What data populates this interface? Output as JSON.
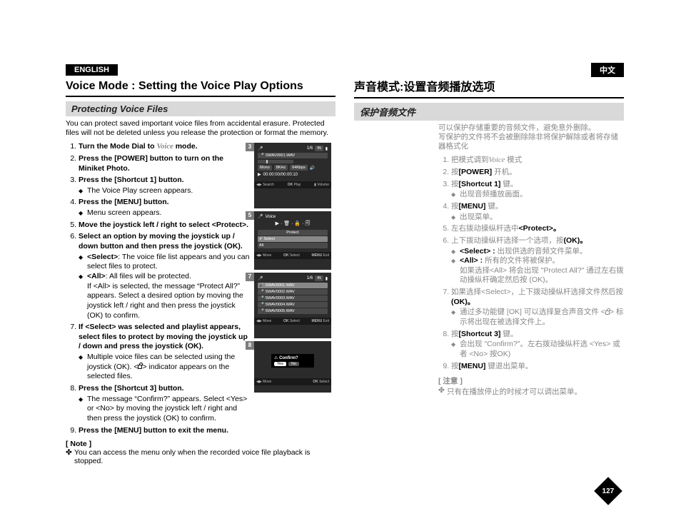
{
  "left": {
    "lang": "ENGLISH",
    "title": "Voice Mode : Setting the Voice Play Options",
    "subtitle": "Protecting Voice Files",
    "intro": "You can protect saved important voice files from accidental erasure. Protected files will not be deleted unless you release the protection or format the memory.",
    "steps": {
      "s1": "Turn the Mode Dial to ",
      "s1_mode": "Voice",
      "s1_tail": " mode.",
      "s2": "Press the [POWER] button to turn on the Miniket Photo.",
      "s3": "Press the [Shortcut 1] button.",
      "s3_sub1": "The Voice Play screen appears.",
      "s4": "Press the [MENU] button.",
      "s4_sub1": "Menu screen appears.",
      "s5": "Move the joystick left / right to select <Protect>.",
      "s6": "Select an option by moving the joystick up / down button and then press the joystick (OK).",
      "s6_sub1_label": "<Select>",
      "s6_sub1_text": ": The voice file list appears and you can select files to protect.",
      "s6_sub2_label": "<All>",
      "s6_sub2_text": ": All files will be protected.",
      "s6_sub2_extra": "If <All> is selected, the message “Protect All?” appears. Select a desired option by moving the joystick left / right and then press the joystick (OK) to confirm.",
      "s7": "If <Select> was selected and playlist appears, select files to protect by moving the joystick up / down and press the joystick (OK).",
      "s7_sub1": "Multiple voice files can be selected using the joystick (OK). <",
      "s7_sub1_icon": "lock",
      "s7_sub1_tail": "> indicator appears on the selected files.",
      "s8": "Press the [Shortcut 3] button.",
      "s8_sub1": "The message “Confirm?” appears. Select <Yes> or <No> by moving the joystick left / right and then press the joystick (OK) to confirm.",
      "s9": "Press the [MENU] button to exit the menu."
    },
    "note_head": "[ Note ]",
    "note_body": "You can access the menu only when the recorded voice file playback is stopped."
  },
  "right": {
    "lang": "中文",
    "title": "声音模式:设置音频播放选项",
    "subtitle": "保护音频文件",
    "intro_l1": "可以保护存储重要的音频文件，避免意外删除。",
    "intro_l2": "写保护的文件将不会被删除除非将保护解除或者将存储器格式化",
    "steps": {
      "s1_a": "把模式调到",
      "s1_b": "Voice",
      "s1_c": " 模式",
      "s2_a": "按",
      "s2_b": "[POWER]",
      "s2_c": " 开机。",
      "s3_a": "按",
      "s3_b": "[Shortcut 1]",
      "s3_c": " 键。",
      "s3_sub1": "出现音频播放画面。",
      "s4_a": "按",
      "s4_b": "[MENU]",
      "s4_c": " 键。",
      "s4_sub1": "出现菜单。",
      "s5_a": "左右拨动操纵杆选中",
      "s5_b": "<Protect>。",
      "s6_a": "上下拨动操纵杆选择一个选项，按",
      "s6_b": "(OK)。",
      "s6_sub1_label": "<Select> :",
      "s6_sub1_text": " 出现供选的音频文件菜单。",
      "s6_sub2_label": "<All> :",
      "s6_sub2_text": " 所有的文件将被保护。",
      "s6_sub2_extra": "如果选择<All> 将会出现 \"Protect All?\" 通过左右拨动操纵杆确定然后按 (OK)。",
      "s7_a": "如果选择<Select>，上下拨动操纵杆选择文件然后按",
      "s7_b": "(OK)。",
      "s7_sub1_a": "通过多功能键 [OK] 可以选择复合声音文件 <",
      "s7_sub1_b": "> 标示将出现在被选择文件上。",
      "s8_a": "按",
      "s8_b": "[Shortcut 3]",
      "s8_c": " 键。",
      "s8_sub1": "会出现 \"Confirm?\"。左右拨动操纵杆选 <Yes> 或者 <No> 按OK)",
      "s9_a": "按",
      "s9_b": "[MENU]",
      "s9_c": " 键退出菜单。"
    },
    "note_head": "[ 注意 ]",
    "note_body": "只有在播放停止的时候才可以调出菜单。"
  },
  "figs": {
    "b3": "3",
    "b5": "5",
    "b7": "7",
    "b8": "8",
    "fname": "SWAV0001.WAV",
    "mono": "Mono",
    "khz": "8KHz",
    "bps": "64Kbps",
    "time": "00:00:00/00:00:10",
    "counter": "1/6",
    "in": "IN",
    "search": "Search",
    "play": "Play",
    "volume": "Volume",
    "ok": "OK",
    "move": "Move",
    "select_lbl": "Select",
    "menu": "MENU",
    "exit": "Exit",
    "voice_hdr": "Voice",
    "protect": "Protect",
    "sel_item": "Select",
    "all_item": "All",
    "f2": "SWAV0002.WAV",
    "f3": "SWAV0003.WAV",
    "f4": "SWAV0004.WAV",
    "f5": "SWAV0005.WAV",
    "confirm": "Confirm?",
    "yes": "Yes",
    "no": "No"
  },
  "page": "127"
}
